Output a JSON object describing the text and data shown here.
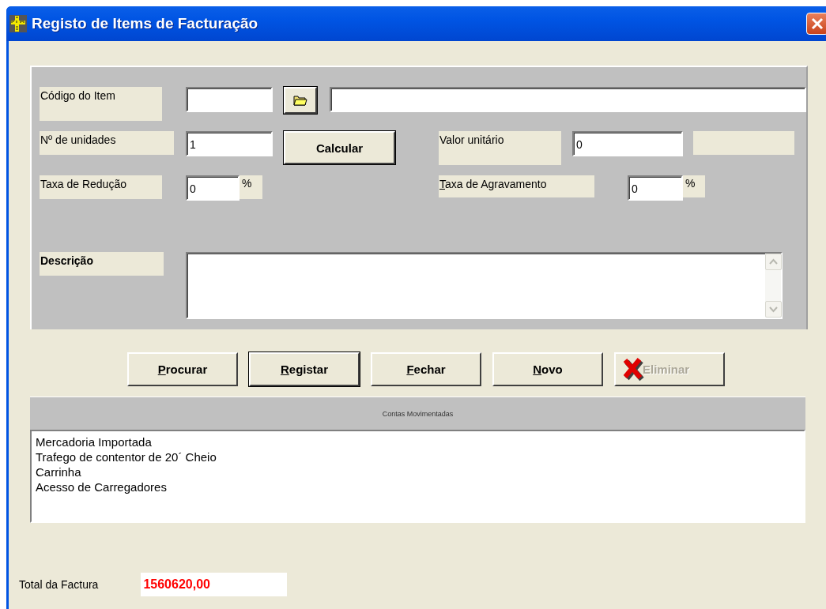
{
  "window": {
    "title": "Registo de Items de Facturação"
  },
  "item_code": {
    "label": "Código do Item"
  },
  "units": {
    "label": "Nº de unidades",
    "value": "1"
  },
  "calculate_button": {
    "label": "Calcular"
  },
  "unit_value": {
    "label": "Valor unitário",
    "value": "0"
  },
  "reduction_rate": {
    "label": "Taxa de Redução",
    "value": "0",
    "unit": "%",
    "mnemonic": false
  },
  "surcharge_rate": {
    "label": "Taxa de Agravamento",
    "value": "0",
    "unit": "%",
    "mnemonic": true
  },
  "description": {
    "label": "Descrição"
  },
  "buttons": [
    {
      "label": "Procurar",
      "mnemonic": true,
      "default": false,
      "disabled": false
    },
    {
      "label": "Registar",
      "mnemonic": true,
      "default": true,
      "disabled": false
    },
    {
      "label": "Fechar",
      "mnemonic": true,
      "default": false,
      "disabled": false
    },
    {
      "label": "Novo",
      "mnemonic": true,
      "default": false,
      "disabled": false
    },
    {
      "label": "Eliminar",
      "mnemonic": false,
      "default": false,
      "disabled": true
    }
  ],
  "accounts": {
    "title": "Contas Movimentadas",
    "items": [
      "Mercadoria Importada",
      "Trafego de contentor de 20´ Cheio",
      "Carrinha",
      "Acesso de Carregadores"
    ]
  },
  "total": {
    "label": "Total da Factura",
    "value": "1560620,00"
  }
}
